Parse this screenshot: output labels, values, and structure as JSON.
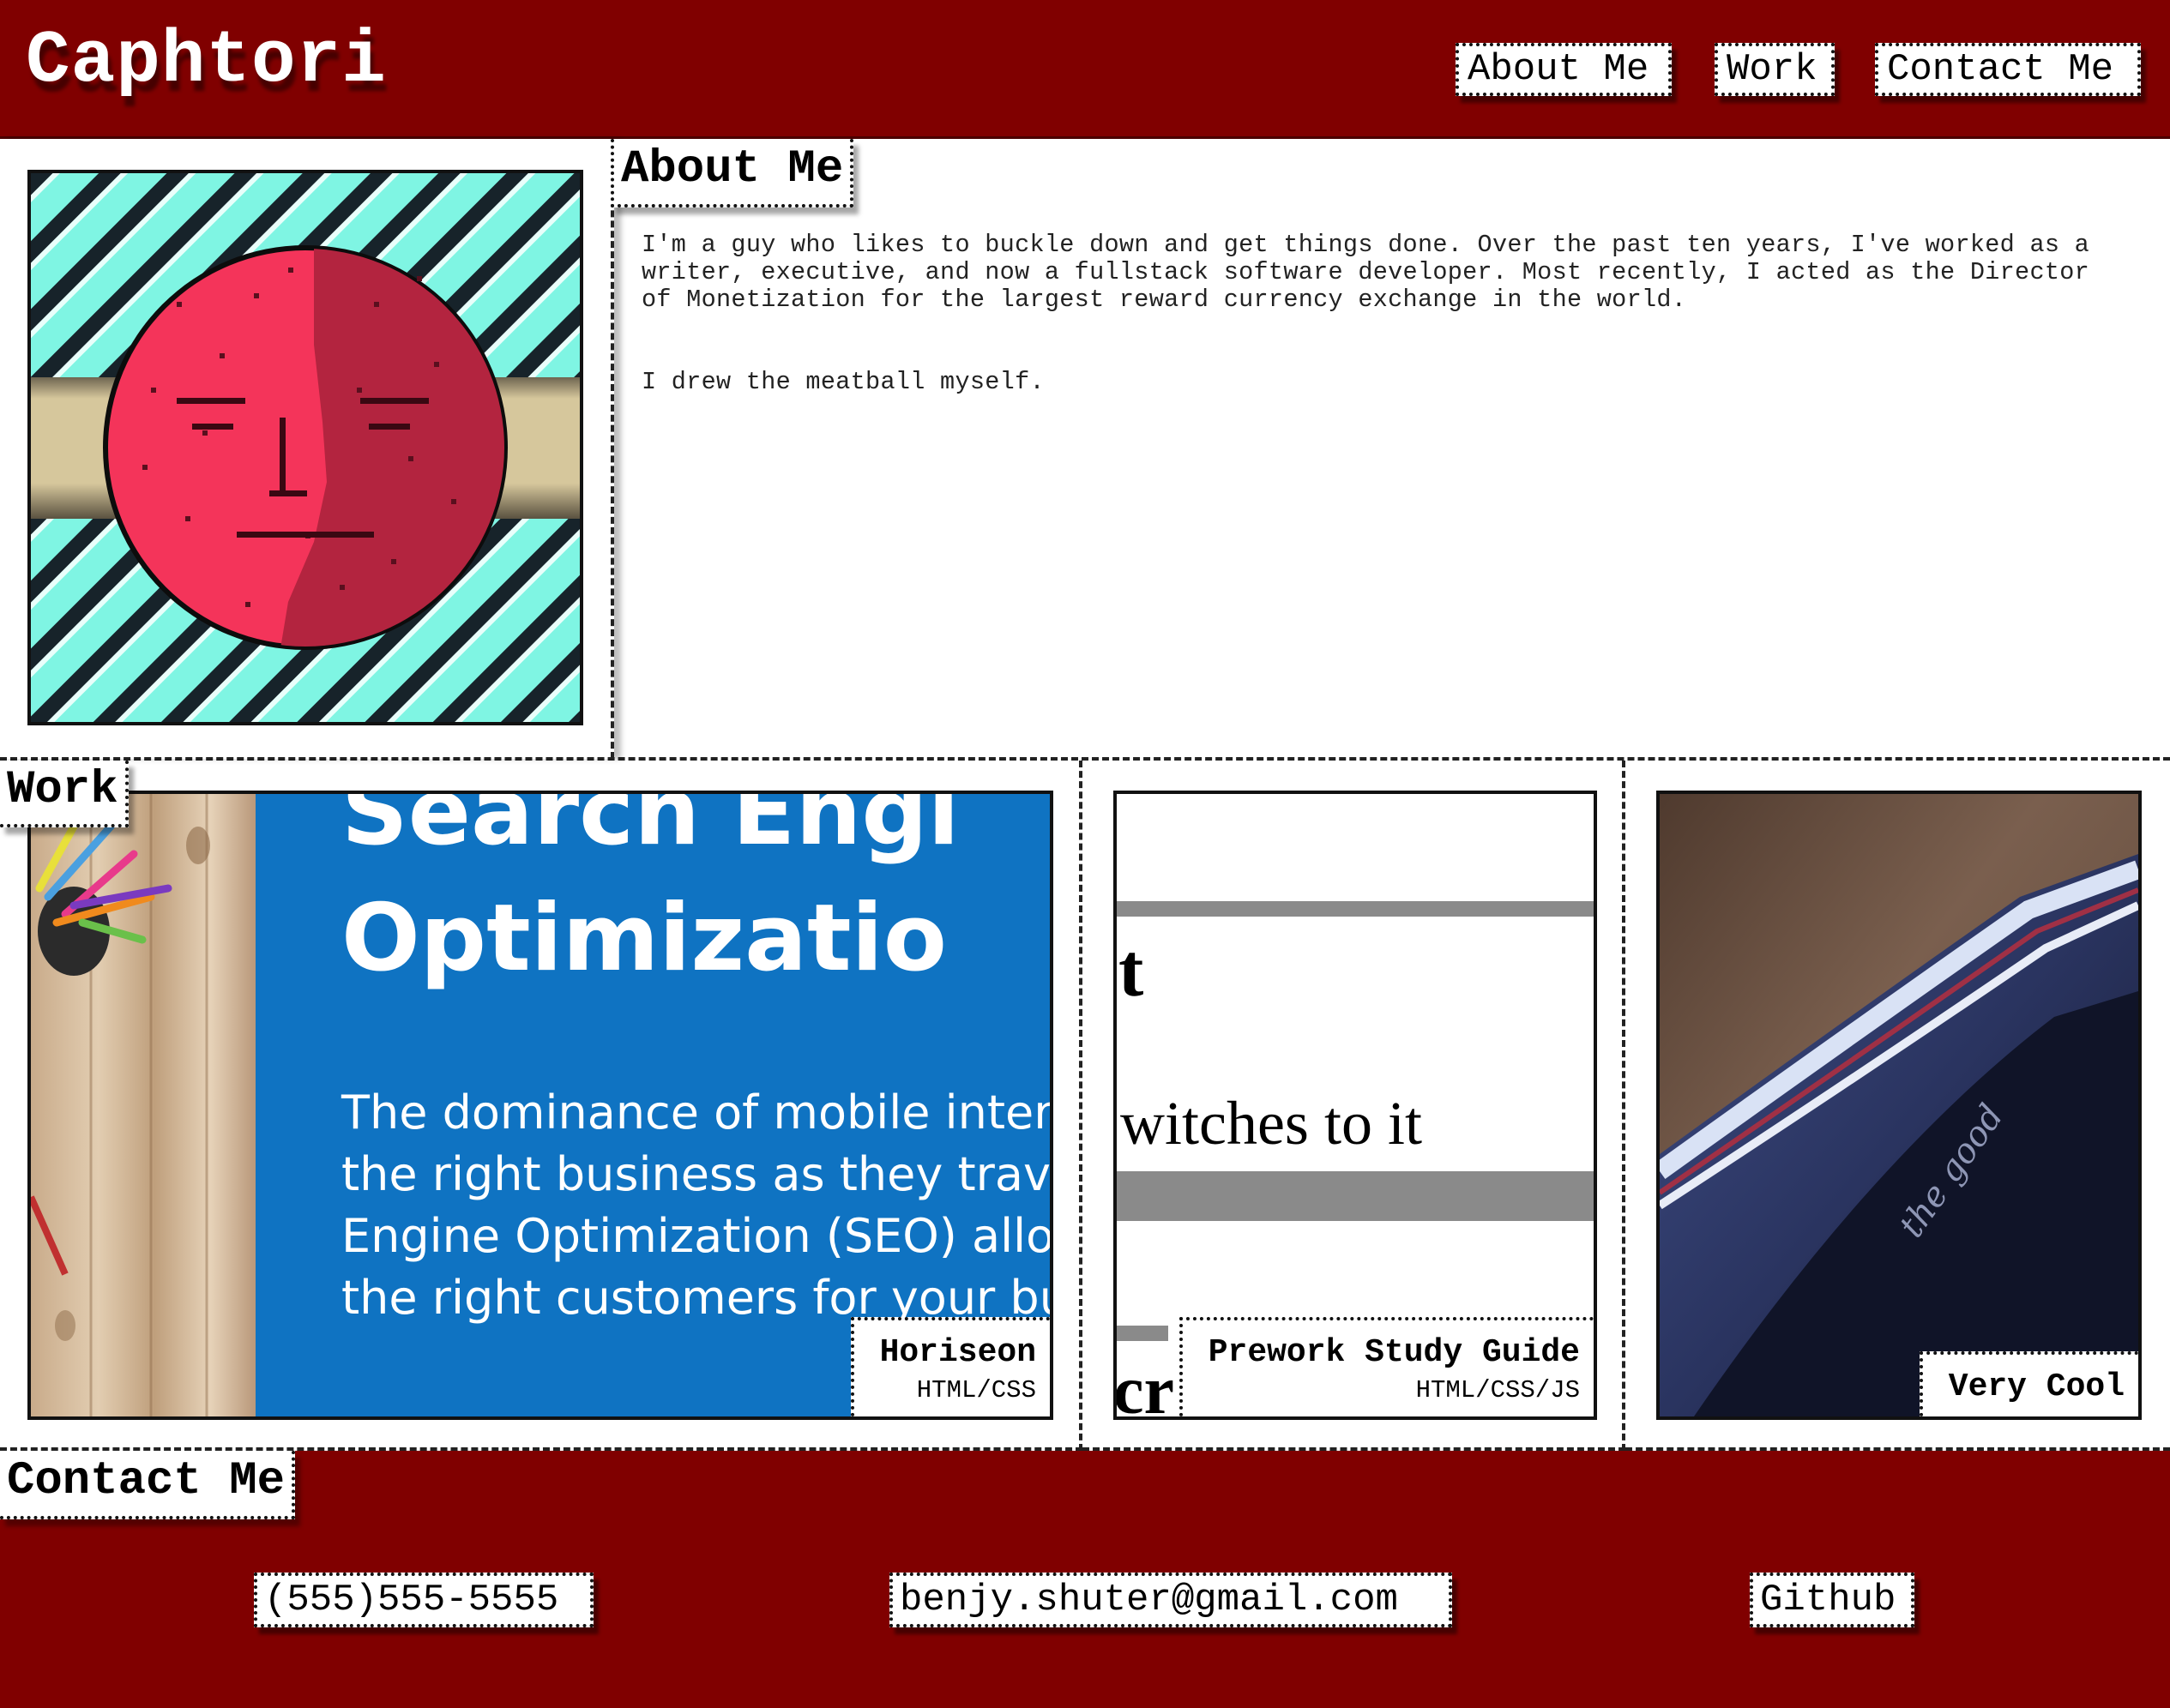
{
  "header": {
    "brand": "Caphtori",
    "nav": [
      {
        "label": "About Me"
      },
      {
        "label": "Work"
      },
      {
        "label": "Contact Me"
      }
    ]
  },
  "about": {
    "heading": "About Me",
    "paragraphs": [
      "I'm a guy who likes to buckle down and get things done. Over the past ten years, I've worked as a writer, executive, and now a fullstack software developer. Most recently, I acted as the Director of Monetization for the largest reward currency exchange in the world.",
      "I drew the meatball myself."
    ],
    "avatar": {
      "icon": "meatball-portrait",
      "bg_color": "#7ff5e3",
      "face_color": "#f4345a",
      "shade_color": "#b3243f",
      "band_color": "#d6c79c"
    }
  },
  "work": {
    "heading": "Work",
    "projects": [
      {
        "title": "Horiseon",
        "tech": "HTML/CSS",
        "screenshot": {
          "headline_line1": "Search Engi",
          "headline_line2": "Optimizatio",
          "body_lines": [
            "The dominance of mobile intern",
            "the right business as they travel,",
            "Engine Optimization (SEO) allov",
            "the right customers for your bu"
          ],
          "panel_color": "#0f73c2"
        }
      },
      {
        "title": "Prework Study Guide",
        "tech": "HTML/CSS/JS",
        "screenshot": {
          "fragment_top": "t",
          "fragment_mid": "witches to it",
          "fragment_bottom": "cr"
        }
      },
      {
        "title": "Very Cool",
        "tech": "",
        "screenshot": {
          "icon": "blurry-photo"
        }
      }
    ]
  },
  "contact": {
    "heading": "Contact Me",
    "phone": "(555)555-5555",
    "email": "benjy.shuter@gmail.com",
    "github": "Github"
  },
  "colors": {
    "brand_red": "#800000",
    "white": "#ffffff",
    "ink": "#000000"
  }
}
